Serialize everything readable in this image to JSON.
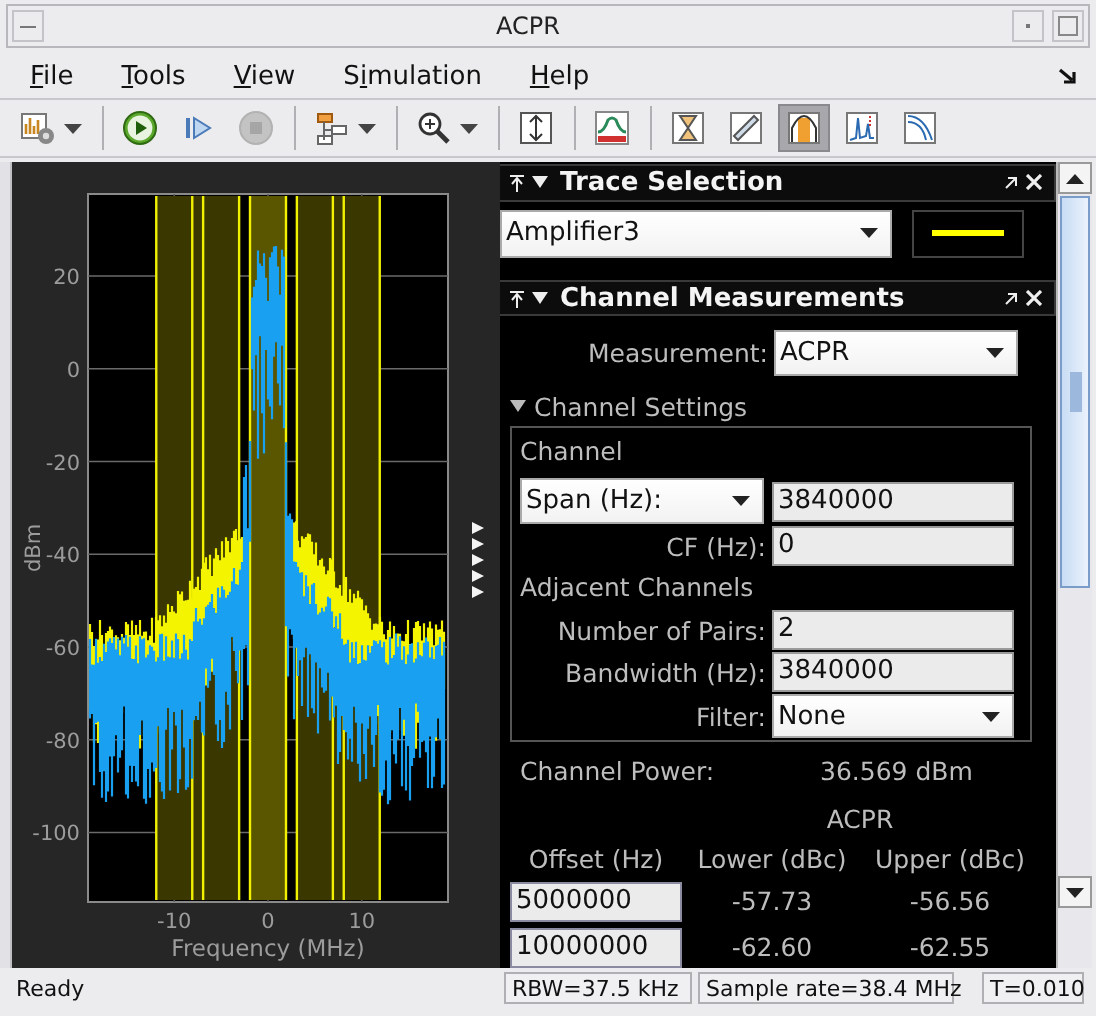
{
  "window": {
    "title": "ACPR"
  },
  "menu": [
    {
      "label": "File"
    },
    {
      "label": "Tools"
    },
    {
      "label": "View"
    },
    {
      "label": "Simulation"
    },
    {
      "label": "Help"
    }
  ],
  "toolbar": [
    {
      "kind": "settings",
      "dropdown": true,
      "selected": false,
      "disabled": false
    },
    {
      "kind": "separator"
    },
    {
      "kind": "run",
      "dropdown": false,
      "selected": false,
      "disabled": false
    },
    {
      "kind": "step",
      "dropdown": false,
      "selected": false,
      "disabled": false
    },
    {
      "kind": "stop",
      "dropdown": false,
      "selected": false,
      "disabled": true
    },
    {
      "kind": "separator"
    },
    {
      "kind": "blocks",
      "dropdown": true,
      "selected": false,
      "disabled": false
    },
    {
      "kind": "separator"
    },
    {
      "kind": "zoom",
      "dropdown": true,
      "selected": false,
      "disabled": false
    },
    {
      "kind": "separator"
    },
    {
      "kind": "autoscale",
      "dropdown": false,
      "selected": false,
      "disabled": false
    },
    {
      "kind": "separator"
    },
    {
      "kind": "spectrum",
      "dropdown": false,
      "selected": false,
      "disabled": false
    },
    {
      "kind": "separator"
    },
    {
      "kind": "cursor",
      "dropdown": false,
      "selected": false,
      "disabled": false
    },
    {
      "kind": "ruler",
      "dropdown": false,
      "selected": false,
      "disabled": false
    },
    {
      "kind": "bands",
      "dropdown": false,
      "selected": true,
      "disabled": false
    },
    {
      "kind": "peaks",
      "dropdown": false,
      "selected": false,
      "disabled": false
    },
    {
      "kind": "ccdf",
      "dropdown": false,
      "selected": false,
      "disabled": false
    }
  ],
  "plot": {
    "ylabel": "dBm",
    "xlabel": "Frequency (MHz)",
    "yticks": [
      "20",
      "0",
      "-20",
      "-40",
      "-60",
      "-80",
      "-100"
    ],
    "xticks": [
      "-10",
      "0",
      "10"
    ]
  },
  "trace_selection": {
    "title": "Trace Selection",
    "trace": "Amplifier3"
  },
  "channel_measurements": {
    "title": "Channel Measurements",
    "measurement": {
      "label": "Measurement:",
      "value": "ACPR"
    },
    "channel_settings": {
      "label": "Channel Settings",
      "expanded": true,
      "channel_heading": "Channel",
      "span": {
        "label": "Span (Hz):",
        "value": "3840000"
      },
      "cf": {
        "label": "CF (Hz):",
        "value": "0"
      },
      "adjacent_heading": "Adjacent Channels",
      "pairs": {
        "label": "Number of Pairs:",
        "value": "2"
      },
      "bandwidth": {
        "label": "Bandwidth (Hz):",
        "value": "3840000"
      },
      "filter": {
        "label": "Filter:",
        "value": "None"
      }
    },
    "channel_power": {
      "label": "Channel Power:",
      "value": "36.569 dBm"
    },
    "acpr_table": {
      "title": "ACPR",
      "columns": [
        "Offset (Hz)",
        "Lower (dBc)",
        "Upper (dBc)"
      ],
      "rows": [
        [
          "5000000",
          "-57.73",
          "-56.56"
        ],
        [
          "10000000",
          "-62.60",
          "-62.55"
        ]
      ]
    }
  },
  "status_bar": {
    "message": "Ready",
    "rbw": "RBW=37.5 kHz",
    "sample_rate": "Sample rate=38.4 MHz",
    "time": "T=0.010"
  }
}
